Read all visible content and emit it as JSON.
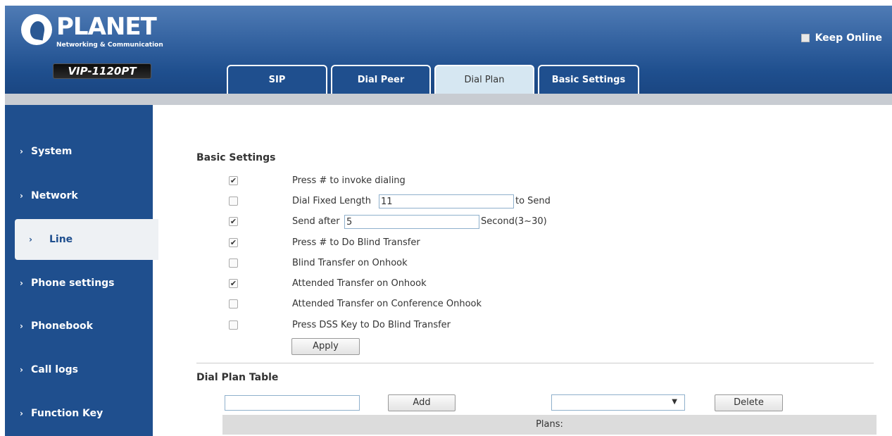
{
  "header": {
    "logo_text": "PLANET",
    "logo_subtitle": "Networking & Communication",
    "model": "VIP-1120PT",
    "keep_online_label": "Keep Online"
  },
  "tabs": [
    {
      "label": "SIP",
      "active": false
    },
    {
      "label": "Dial Peer",
      "active": false
    },
    {
      "label": "Dial Plan",
      "active": true
    },
    {
      "label": "Basic Settings",
      "active": false
    }
  ],
  "sidebar": {
    "items": [
      {
        "label": "System",
        "active": false
      },
      {
        "label": "Network",
        "active": false
      },
      {
        "label": "Line",
        "active": true
      },
      {
        "label": "Phone settings",
        "active": false
      },
      {
        "label": "Phonebook",
        "active": false
      },
      {
        "label": "Call logs",
        "active": false
      },
      {
        "label": "Function Key",
        "active": false
      }
    ]
  },
  "basic_settings": {
    "title": "Basic Settings",
    "options": [
      {
        "label": "Press # to invoke dialing",
        "checked": true
      },
      {
        "label": "Dial Fixed Length",
        "checked": false,
        "value": "11",
        "suffix": "to Send"
      },
      {
        "label": "Send after",
        "checked": true,
        "value": "5",
        "suffix": "Second(3~30)"
      },
      {
        "label": "Press # to Do Blind Transfer",
        "checked": true
      },
      {
        "label": "Blind Transfer on Onhook",
        "checked": false
      },
      {
        "label": "Attended Transfer on Onhook",
        "checked": true
      },
      {
        "label": "Attended Transfer on Conference Onhook",
        "checked": false
      },
      {
        "label": "Press DSS Key to Do Blind Transfer",
        "checked": false
      }
    ],
    "apply_label": "Apply"
  },
  "dial_plan_table": {
    "title": "Dial Plan Table",
    "input_value": "",
    "add_label": "Add",
    "select_value": "",
    "delete_label": "Delete",
    "plans_header": "Plans:"
  }
}
